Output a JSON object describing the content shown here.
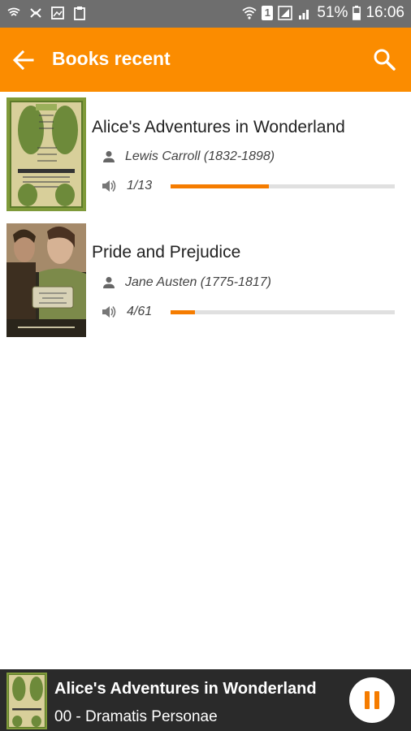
{
  "status_bar": {
    "battery": "51%",
    "time": "16:06",
    "sim_label": "1"
  },
  "app_bar": {
    "title": "Books recent",
    "color": "#fb8c00"
  },
  "books": [
    {
      "title": "Alice's Adventures in Wonderland",
      "author": "Lewis Carroll (1832-1898)",
      "progress_text": "1/13",
      "progress_fraction": 0.44
    },
    {
      "title": "Pride and Prejudice",
      "author": "Jane Austen (1775-1817)",
      "progress_text": "4/61",
      "progress_fraction": 0.11
    }
  ],
  "player": {
    "title": "Alice's Adventures in Wonderland",
    "chapter": "00 - Dramatis Personae"
  }
}
